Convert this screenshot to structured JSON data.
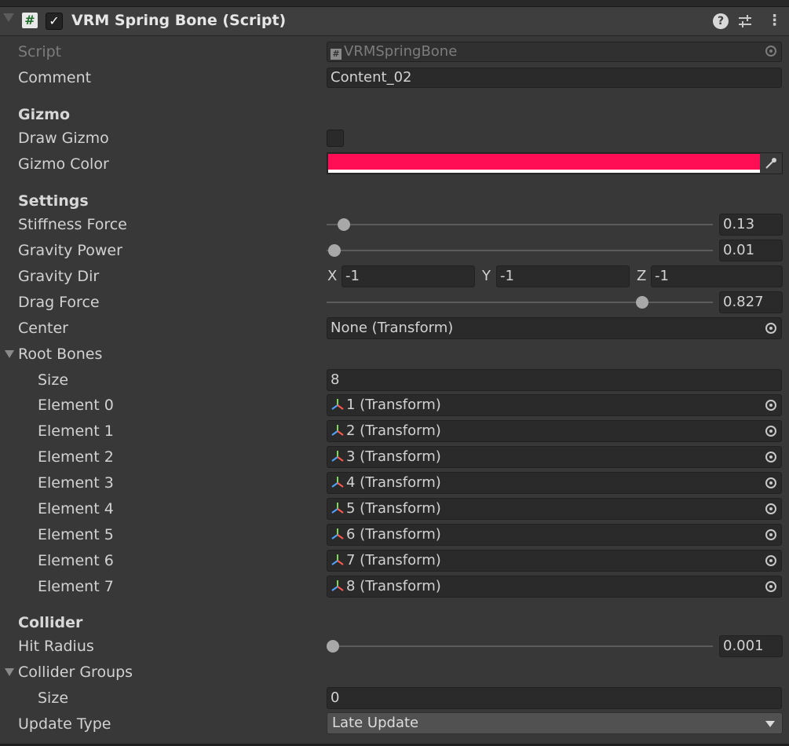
{
  "header": {
    "title": "VRM Spring Bone (Script)",
    "enabled": true,
    "icons": [
      "script-icon",
      "help-icon",
      "preset-icon",
      "context-menu-icon"
    ]
  },
  "script": {
    "label": "Script",
    "value": "VRMSpringBone"
  },
  "comment": {
    "label": "Comment",
    "value": "Content_02"
  },
  "gizmo": {
    "section": "Gizmo",
    "draw_label": "Draw Gizmo",
    "draw_checked": false,
    "color_label": "Gizmo Color",
    "color": "#ff0d55"
  },
  "settings": {
    "section": "Settings",
    "stiffness": {
      "label": "Stiffness Force",
      "value": "0.13",
      "fraction": 0.05
    },
    "gravity_power": {
      "label": "Gravity Power",
      "value": "0.01",
      "fraction": 0.005
    },
    "gravity_dir": {
      "label": "Gravity Dir",
      "x_label": "X",
      "x": "-1",
      "y_label": "Y",
      "y": "-1",
      "z_label": "Z",
      "z": "-1"
    },
    "drag": {
      "label": "Drag Force",
      "value": "0.827",
      "fraction": 0.817
    },
    "center": {
      "label": "Center",
      "value": "None (Transform)"
    }
  },
  "root_bones": {
    "label": "Root Bones",
    "size_label": "Size",
    "size": "8",
    "elements": [
      {
        "label": "Element 0",
        "value": "1 (Transform)"
      },
      {
        "label": "Element 1",
        "value": "2 (Transform)"
      },
      {
        "label": "Element 2",
        "value": "3 (Transform)"
      },
      {
        "label": "Element 3",
        "value": "4 (Transform)"
      },
      {
        "label": "Element 4",
        "value": "5 (Transform)"
      },
      {
        "label": "Element 5",
        "value": "6 (Transform)"
      },
      {
        "label": "Element 6",
        "value": "7 (Transform)"
      },
      {
        "label": "Element 7",
        "value": "8 (Transform)"
      }
    ]
  },
  "collider": {
    "section": "Collider",
    "hit_radius": {
      "label": "Hit Radius",
      "value": "0.001",
      "fraction": 0.0
    },
    "groups_label": "Collider Groups",
    "groups_size_label": "Size",
    "groups_size": "0"
  },
  "update_type": {
    "label": "Update Type",
    "value": "Late Update"
  },
  "colors": {
    "background": "#383838",
    "field": "#2a2a2a",
    "accent": "#ff0d55"
  }
}
